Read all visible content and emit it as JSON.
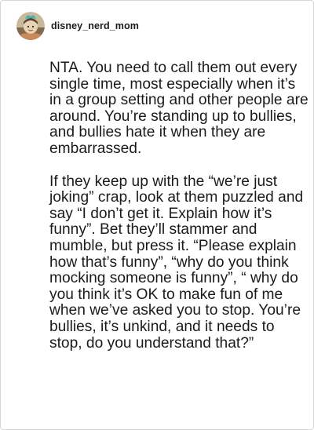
{
  "post": {
    "username": "disney_nerd_mom",
    "avatar_icon": "avatar-icon",
    "paragraphs": [
      "NTA. You need to call them out every single time, most especially when it’s in a group setting and other people are around. You’re standing up to bullies, and bullies hate it when they are embarrassed.",
      "If they keep up with the “we’re just joking” crap, look at them puzzled and say “I don’t get it. Explain how it’s funny”. Bet they’ll stammer and mumble, but press it. “Please explain how that’s funny”, “why do you think mocking someone is funny”, “ why do you think it’s OK to make fun of me when we’ve asked you to stop. You’re bullies, it’s unkind, and it needs to stop, do you understand that?”"
    ]
  }
}
